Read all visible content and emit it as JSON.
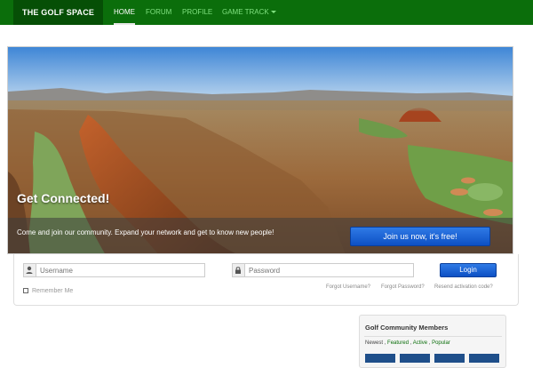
{
  "navbar": {
    "brand": "THE GOLF SPACE",
    "items": [
      {
        "label": "HOME",
        "active": true
      },
      {
        "label": "FORUM",
        "active": false
      },
      {
        "label": "PROFILE",
        "active": false
      },
      {
        "label": "GAME TRACK",
        "active": false,
        "has_dropdown": true
      }
    ]
  },
  "hero": {
    "title": "Get Connected!",
    "subtitle": "Come and join our community. Expand your network and get to know new people!",
    "cta_label": "Join us now, it's free!"
  },
  "login": {
    "username_placeholder": "Username",
    "password_placeholder": "Password",
    "login_label": "Login",
    "remember_label": "Remember Me",
    "forgot_username": "Forgot Username?",
    "forgot_password": "Forgot Password?",
    "resend_activation": "Resend activation code?"
  },
  "members": {
    "title": "Golf Community Members",
    "filter_newest": "Newest",
    "filter_featured": "Featured",
    "filter_active": "Active",
    "filter_popular": "Popular"
  },
  "colors": {
    "nav_bg": "#0b6e0b",
    "brand_bg": "#064f06",
    "button_blue": "#1a5fd6"
  }
}
